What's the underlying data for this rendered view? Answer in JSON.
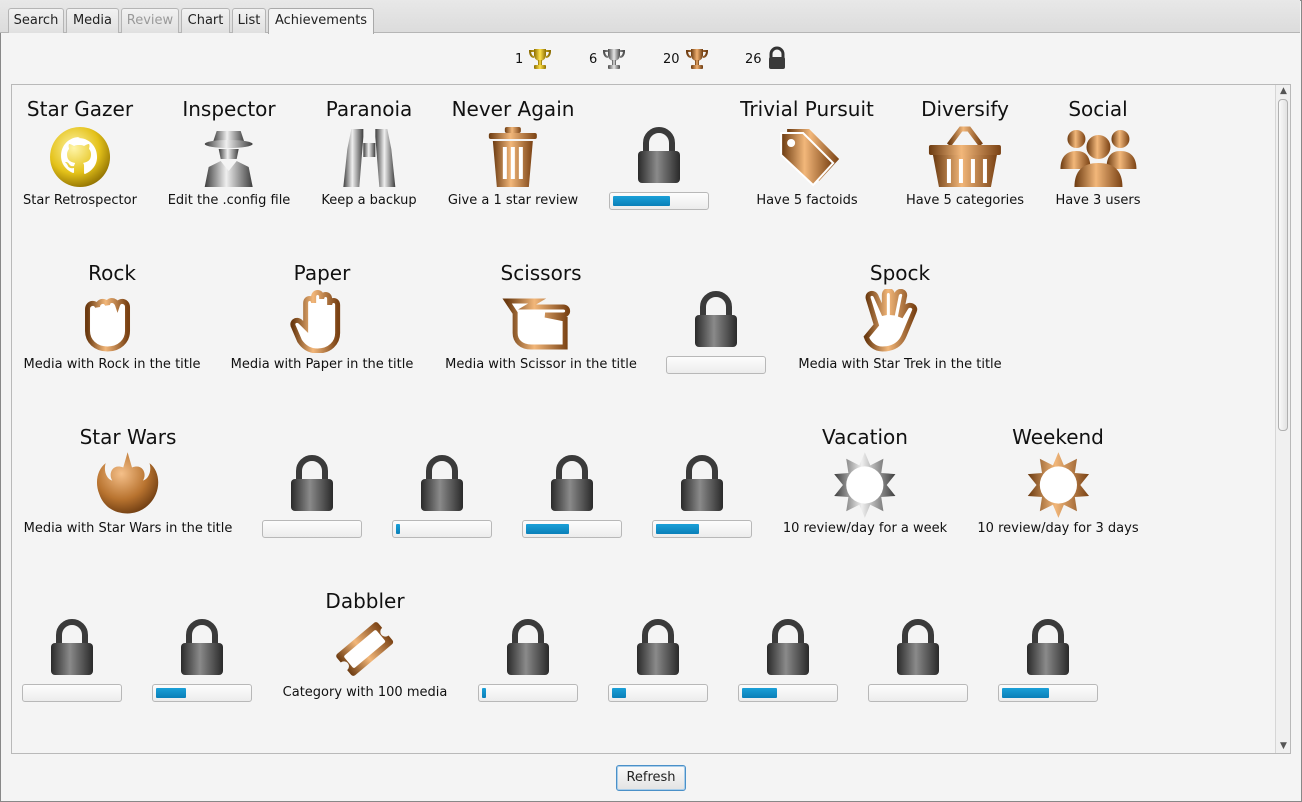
{
  "tabs": [
    {
      "label": "Search",
      "state": "normal"
    },
    {
      "label": "Media",
      "state": "normal"
    },
    {
      "label": "Review",
      "state": "disabled"
    },
    {
      "label": "Chart",
      "state": "normal"
    },
    {
      "label": "List",
      "state": "normal"
    },
    {
      "label": "Achievements",
      "state": "active"
    }
  ],
  "summary": {
    "gold_count": "1",
    "silver_count": "6",
    "bronze_count": "20",
    "locked_count": "26"
  },
  "colors": {
    "gold": "#e4c21a",
    "silver": "#9a9a9a",
    "bronze": "#b8732f",
    "lock": "#4a4a4a",
    "progress": "#1593cf"
  },
  "achievements": {
    "star_gazer": {
      "title": "Star Gazer",
      "desc": "Star Retrospector",
      "tier": "gold",
      "icon": "github-cat-icon"
    },
    "inspector": {
      "title": "Inspector",
      "desc": "Edit the .config file",
      "tier": "silver",
      "icon": "spy-icon"
    },
    "paranoia": {
      "title": "Paranoia",
      "desc": "Keep a backup",
      "tier": "silver",
      "icon": "binoculars-icon"
    },
    "never_again": {
      "title": "Never Again",
      "desc": "Give a 1 star review",
      "tier": "bronze",
      "icon": "trash-icon"
    },
    "trivial_pursuit": {
      "title": "Trivial Pursuit",
      "desc": "Have 5 factoids",
      "tier": "bronze",
      "icon": "tags-icon"
    },
    "diversify": {
      "title": "Diversify",
      "desc": "Have 5 categories",
      "tier": "bronze",
      "icon": "basket-icon"
    },
    "social": {
      "title": "Social",
      "desc": "Have 3 users",
      "tier": "bronze",
      "icon": "users-icon"
    },
    "rock": {
      "title": "Rock",
      "desc": "Media with Rock in the title",
      "tier": "bronze",
      "icon": "fist-icon"
    },
    "paper": {
      "title": "Paper",
      "desc": "Media with Paper in the title",
      "tier": "bronze",
      "icon": "open-hand-icon"
    },
    "scissors": {
      "title": "Scissors",
      "desc": "Media with Scissor in the title",
      "tier": "bronze",
      "icon": "scissors-hand-icon"
    },
    "spock": {
      "title": "Spock",
      "desc": "Media with Star Trek in the title",
      "tier": "bronze",
      "icon": "vulcan-hand-icon"
    },
    "star_wars": {
      "title": "Star Wars",
      "desc": "Media with Star Wars in the title",
      "tier": "bronze",
      "icon": "rebel-alliance-icon"
    },
    "vacation": {
      "title": "Vacation",
      "desc": "10 review/day for a week",
      "tier": "silver",
      "icon": "sun-icon"
    },
    "weekend": {
      "title": "Weekend",
      "desc": "10 review/day for 3 days",
      "tier": "bronze",
      "icon": "sun-icon"
    },
    "dabbler": {
      "title": "Dabbler",
      "desc": "Category with 100 media",
      "tier": "bronze",
      "icon": "ticket-icon"
    }
  },
  "locked_progress": {
    "row1_a": 0.62,
    "row2_a": 0.0,
    "row3_a": 0.0,
    "row3_b": 0.04,
    "row3_c": 0.47,
    "row3_d": 0.47,
    "row4_a": 0.0,
    "row4_b": 0.33,
    "row4_c": 0.04,
    "row4_d": 0.15,
    "row4_e": 0.38,
    "row4_f": 0.0,
    "row4_g": 0.51
  },
  "refresh_label": "Refresh"
}
